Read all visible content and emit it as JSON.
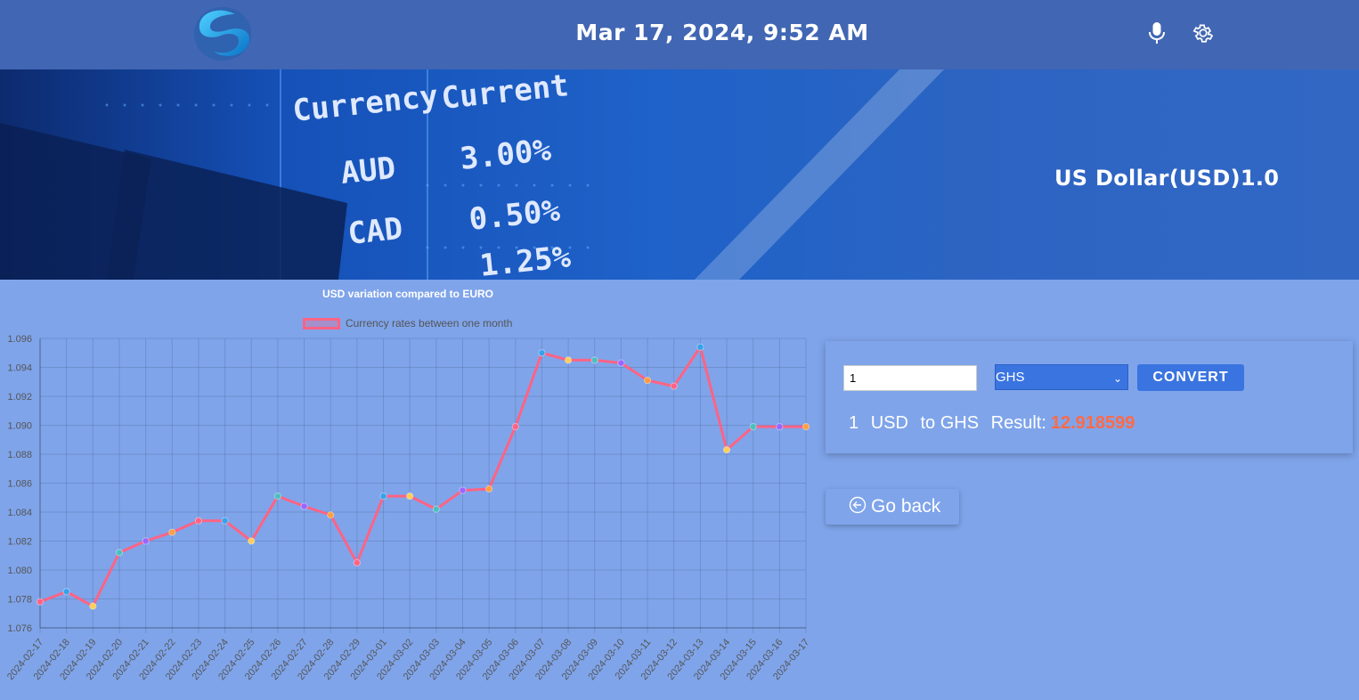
{
  "header": {
    "datetime": "Mar 17, 2024, 9:52 AM",
    "logo_icon": "swirl-logo",
    "mic_icon": "microphone-icon",
    "settings_icon": "gear-icon"
  },
  "banner": {
    "base_currency": "US Dollar(USD)1.0",
    "photo": {
      "heading_currency": "Currency",
      "heading_current": "Current",
      "rows": [
        {
          "code": "AUD",
          "rate": "3.00%"
        },
        {
          "code": "CAD",
          "rate": "0.50%"
        },
        {
          "code": "",
          "rate": "1.25%"
        }
      ]
    }
  },
  "chart_data": {
    "type": "line",
    "title": "USD variation compared to EURO",
    "legend": "Currency rates between one month",
    "legend_position": "top-center",
    "grid": true,
    "line_color": "#ff6384",
    "ylim": [
      1.076,
      1.096
    ],
    "y_ticks": [
      "1.076",
      "1.078",
      "1.080",
      "1.082",
      "1.084",
      "1.086",
      "1.088",
      "1.090",
      "1.092",
      "1.094",
      "1.096"
    ],
    "x": [
      "2024-02-17",
      "2024-02-18",
      "2024-02-19",
      "2024-02-20",
      "2024-02-21",
      "2024-02-22",
      "2024-02-23",
      "2024-02-24",
      "2024-02-25",
      "2024-02-26",
      "2024-02-27",
      "2024-02-28",
      "2024-02-29",
      "2024-03-01",
      "2024-03-02",
      "2024-03-03",
      "2024-03-04",
      "2024-03-05",
      "2024-03-06",
      "2024-03-07",
      "2024-03-08",
      "2024-03-09",
      "2024-03-10",
      "2024-03-11",
      "2024-03-12",
      "2024-03-13",
      "2024-03-14",
      "2024-03-15",
      "2024-03-16",
      "2024-03-17"
    ],
    "series": [
      {
        "values": [
          1.0778,
          1.0785,
          1.0775,
          1.0812,
          1.082,
          1.0826,
          1.0834,
          1.0834,
          1.082,
          1.0851,
          1.0844,
          1.0838,
          1.0805,
          1.0851,
          1.0851,
          1.0842,
          1.0855,
          1.0856,
          1.0899,
          1.095,
          1.0945,
          1.0945,
          1.0943,
          1.0931,
          1.0927,
          1.0954,
          1.0883,
          1.0899,
          1.0899,
          1.0899
        ],
        "point_colors": [
          "#ff6384",
          "#36a2eb",
          "#ffce56",
          "#4bc0c0",
          "#9966ff",
          "#ff9f40",
          "#ff6384",
          "#36a2eb",
          "#ffce56",
          "#4bc0c0",
          "#9966ff",
          "#ff9f40",
          "#ff6384",
          "#36a2eb",
          "#ffce56",
          "#4bc0c0",
          "#9966ff",
          "#ff9f40",
          "#ff6384",
          "#36a2eb",
          "#ffce56",
          "#4bc0c0",
          "#9966ff",
          "#ff9f40",
          "#ff6384",
          "#36a2eb",
          "#ffce56",
          "#4bc0c0",
          "#9966ff",
          "#ff9f40"
        ]
      }
    ]
  },
  "converter": {
    "amount_value": "1",
    "target_currency": "GHS",
    "convert_label": "CONVERT",
    "result_amount": "1",
    "result_from": "USD",
    "result_to": "to GHS",
    "result_label": "Result:",
    "result_value": "12.918599"
  },
  "navigation": {
    "go_back_label": "Go back",
    "go_back_icon": "circle-arrow-left-icon"
  }
}
